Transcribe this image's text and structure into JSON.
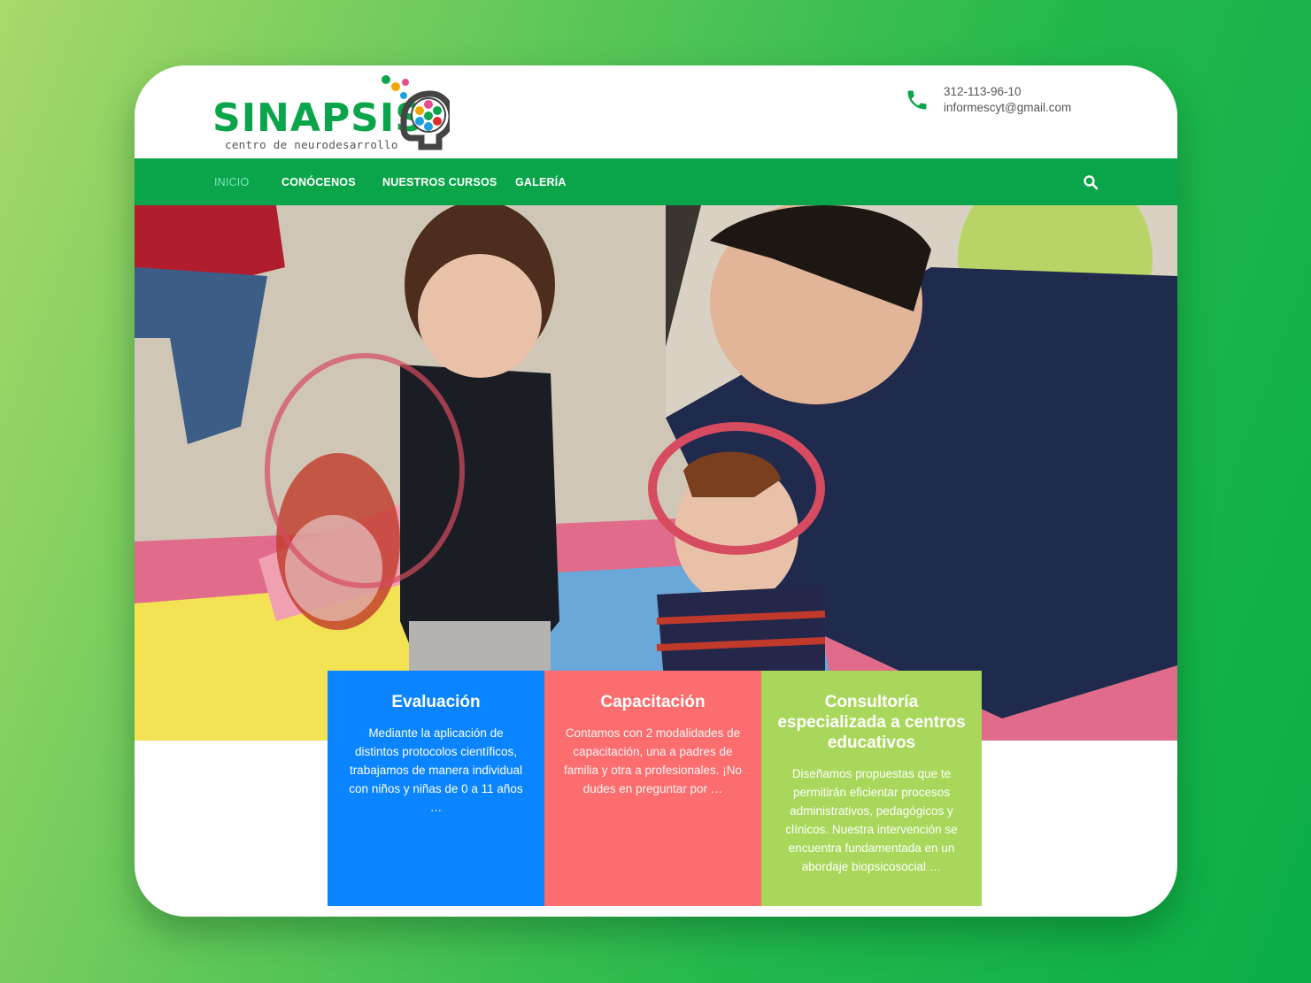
{
  "colors": {
    "brand_green": "#0aa54a",
    "nav_active": "#7fe6bd",
    "card_blue": "#0a84ff",
    "card_coral": "#fb6d6e",
    "card_lime": "#a9d75b"
  },
  "header": {
    "logo": {
      "name": "SINAPSIS",
      "tagline": "centro de neurodesarrollo",
      "icon": "brain-bubbles-icon"
    },
    "contact": {
      "phone": "312-113-96-10",
      "email": "informescyt@gmail.com",
      "icon": "phone-icon"
    }
  },
  "nav": {
    "items": [
      {
        "label": "INICIO",
        "active": true
      },
      {
        "label": "CONÓCENOS",
        "active": false
      },
      {
        "label": "NUESTROS CURSOS",
        "active": false
      },
      {
        "label": "GALERÍA",
        "active": false
      }
    ],
    "search_icon": "search-icon"
  },
  "hero": {
    "image": "children-playing-with-therapist-photo"
  },
  "cards": [
    {
      "title": "Evaluación",
      "body": "Mediante la aplicación de distintos protocolos científicos, trabajamos de manera individual con niños y niñas de 0 a 11 años …"
    },
    {
      "title": "Capacitación",
      "body": "Contamos con 2 modalidades de capacitación, una a padres de familia y otra a profesionales. ¡No dudes en preguntar por …"
    },
    {
      "title": "Consultoría especializada a centros educativos",
      "body": "Diseñamos propuestas que te permitirán eficientar procesos administrativos, pedagógicos y clínicos. Nuestra intervención se encuentra fundamentada en un abordaje biopsicosocial …"
    }
  ]
}
